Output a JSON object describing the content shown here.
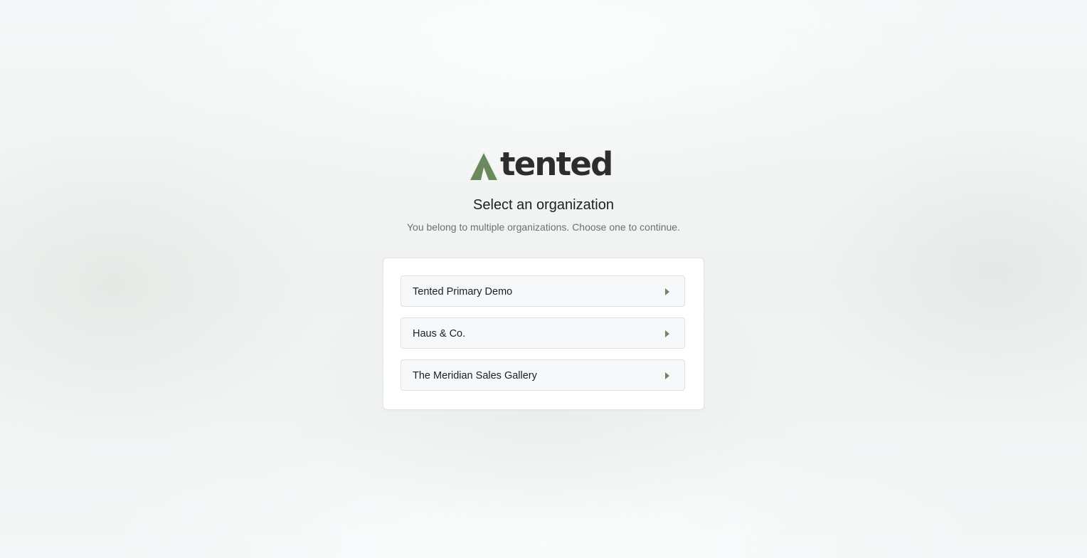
{
  "brand": {
    "name": "tented",
    "logo_color": "#6a8a5e",
    "wordmark_color": "#2d2d2b"
  },
  "heading": {
    "title": "Select an organization",
    "subtitle": "You belong to multiple organizations. Choose one to continue."
  },
  "organizations": [
    {
      "label": "Tented Primary Demo",
      "icon": "chevron-right-icon"
    },
    {
      "label": "Haus & Co.",
      "icon": "chevron-right-icon"
    },
    {
      "label": "The Meridian Sales Gallery",
      "icon": "chevron-right-icon"
    }
  ],
  "colors": {
    "accent": "#6a8a5e",
    "title_text": "#1c1f22",
    "subtitle_text": "#6a7078"
  }
}
